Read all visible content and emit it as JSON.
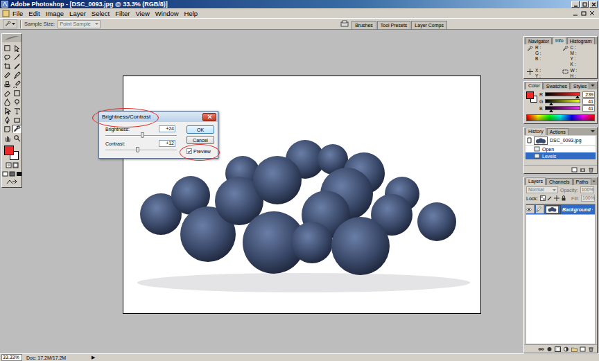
{
  "window": {
    "title": "Adobe Photoshop - [DSC_0093.jpg @ 33.3% (RGB/8)]"
  },
  "menu": [
    "File",
    "Edit",
    "Image",
    "Layer",
    "Select",
    "Filter",
    "View",
    "Window",
    "Help"
  ],
  "options_bar": {
    "sample_size_label": "Sample Size:",
    "sample_size_value": "Point Sample"
  },
  "palette_well": [
    "Brushes",
    "Tool Presets",
    "Layer Comps"
  ],
  "toolbox": {
    "tools": [
      {
        "selected": false
      },
      {
        "selected": false
      },
      {
        "selected": false
      },
      {
        "selected": false
      },
      {
        "selected": false
      },
      {
        "selected": false
      },
      {
        "selected": false
      },
      {
        "selected": false
      },
      {
        "selected": false
      },
      {
        "selected": false
      },
      {
        "selected": false
      },
      {
        "selected": false
      },
      {
        "selected": false
      },
      {
        "selected": false
      },
      {
        "selected": false
      },
      {
        "selected": false
      },
      {
        "selected": false
      },
      {
        "selected": false
      },
      {
        "selected": false
      },
      {
        "selected": true
      },
      {
        "selected": false
      },
      {
        "selected": false
      }
    ]
  },
  "dialog": {
    "title": "Brightness/Contrast",
    "fields": [
      {
        "label": "Brightness:",
        "value": "+24",
        "level": 0.51
      },
      {
        "label": "Contrast:",
        "value": "+12",
        "level": 0.45
      }
    ],
    "buttons": [
      {
        "label": "OK",
        "default": true
      },
      {
        "label": "Cancel",
        "default": false
      }
    ],
    "preview": {
      "label": "Preview",
      "checked": true
    }
  },
  "info_panel": {
    "tabs": [
      {
        "label": "Navigator",
        "selected": false
      },
      {
        "label": "Info",
        "selected": true
      },
      {
        "label": "Histogram",
        "selected": false
      }
    ],
    "groups": [
      [
        "R :",
        "G :",
        "B :"
      ],
      [
        "C :",
        "M :",
        "Y :",
        "K :"
      ],
      [
        "X :",
        "Y :"
      ],
      [
        "W :",
        "H :"
      ]
    ]
  },
  "color_panel": {
    "tabs": [
      {
        "label": "Color",
        "selected": true
      },
      {
        "label": "Swatches",
        "selected": false
      },
      {
        "label": "Styles",
        "selected": false
      }
    ],
    "channels": [
      {
        "label": "R",
        "value": "239",
        "level": 0.94,
        "color": "#ff2929"
      },
      {
        "label": "G",
        "value": "41",
        "level": 0.16,
        "color": "#efff29"
      },
      {
        "label": "B",
        "value": "41",
        "level": 0.16,
        "color": "#ef29ff"
      }
    ]
  },
  "history_panel": {
    "tabs": [
      {
        "label": "History",
        "selected": true
      },
      {
        "label": "Actions",
        "selected": false
      }
    ],
    "snapshot": "DSC_0093.jpg",
    "items": [
      {
        "label": "Open",
        "selected": false
      },
      {
        "label": "Levels",
        "selected": true
      }
    ]
  },
  "layers_panel": {
    "tabs": [
      {
        "label": "Layers",
        "selected": true
      },
      {
        "label": "Channels",
        "selected": false
      },
      {
        "label": "Paths",
        "selected": false
      }
    ],
    "blend_mode": "Normal",
    "opacity_label": "Opacity:",
    "opacity": "100%",
    "lock_label": "Lock:",
    "fill_label": "Fill:",
    "fill": "100%",
    "layers": [
      {
        "name": "Background",
        "selected": true,
        "visible": true,
        "locked": true
      }
    ]
  },
  "status_bar": {
    "zoom": "33.33%",
    "doc": "Doc: 17.2M/17.2M",
    "arrow": "▶"
  }
}
